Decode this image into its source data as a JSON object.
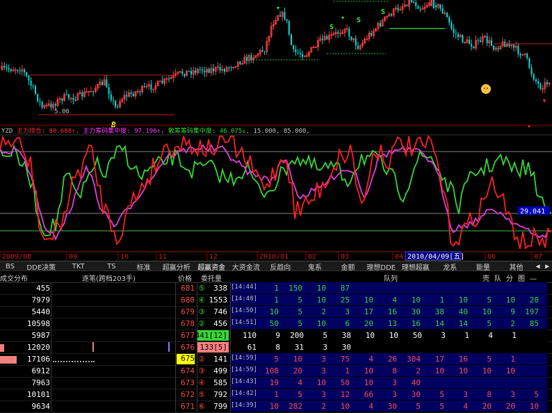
{
  "chart": {
    "indicator_name": "YZD",
    "legend": [
      {
        "label": "主力持仓",
        "value": "80.688↑",
        "color": "#ff3030"
      },
      {
        "label": "主力筹码集中度",
        "value": "97.196↑",
        "color": "#ff3cff"
      },
      {
        "label": "散筹筹码集中度",
        "value": "46.075↓",
        "color": "#35d835"
      },
      {
        "label": "",
        "value": "15.000",
        "color": "#c0c0c0"
      },
      {
        "label": "",
        "value": "85.000",
        "color": "#c0c0c0"
      }
    ],
    "value_tag": "29.041",
    "date_tag": "2010/04/09[五]",
    "months": [
      "2009/08",
      "09",
      "10",
      "11",
      "12",
      "2010/01",
      "02",
      "03",
      "04",
      "05",
      "06",
      "07"
    ],
    "candle_price_label": "5.00",
    "b_marker": "B",
    "s_markers": [
      "S",
      "S",
      "S"
    ]
  },
  "tabs": [
    "BS",
    "DDE决策",
    "TKT",
    "TS",
    "标准",
    "超赢分析",
    "超赢资金",
    "大资金流",
    "反趋向",
    "鬼系",
    "金额",
    "理想DDE",
    "理想超赢",
    "龙系",
    "能量",
    "其他"
  ],
  "tab_nav": [
    "◀",
    "▶"
  ],
  "header": {
    "col_dist": "成交分布",
    "col_ticks": "逐笔(跨档203手)",
    "col_price": "价格",
    "col_order": "委托量",
    "col_queue": "队列",
    "right_tabs": [
      "壳",
      "队",
      "分",
      "图",
      "—",
      "×"
    ]
  },
  "colors": {
    "up": "#ff4b4b",
    "green": "#35d835",
    "yellow": "#ffff00",
    "white": "#ffffff",
    "blue_bg": "#000060"
  },
  "rows": [
    {
      "vol": "455",
      "bar": 0,
      "price": "681",
      "num": "⑤",
      "qty": "338",
      "time": "[14:44]",
      "queue": [
        "1",
        "150",
        "10",
        "87"
      ]
    },
    {
      "vol": "7979",
      "bar": 0,
      "price": "680",
      "num": "④",
      "qty": "1553",
      "time": "[14:48]",
      "queue": [
        "1",
        "5",
        "10",
        "25",
        "10",
        "4",
        "10",
        "1",
        "10",
        "5",
        "10",
        "20"
      ]
    },
    {
      "vol": "5440",
      "bar": 0,
      "price": "679",
      "num": "③",
      "qty": "746",
      "time": "[14:50]",
      "queue": [
        "10",
        "5",
        "2",
        "3",
        "17",
        "16",
        "30",
        "38",
        "40",
        "10",
        "9",
        "197"
      ]
    },
    {
      "vol": "10598",
      "bar": 0,
      "price": "678",
      "num": "②",
      "qty": "456",
      "time": "[14:51]",
      "queue": [
        "50",
        "5",
        "10",
        "6",
        "20",
        "13",
        "16",
        "14",
        "14",
        "5",
        "2",
        "85"
      ]
    },
    {
      "vol": "5987",
      "bar": 0,
      "price": "677",
      "num": "",
      "qty": "441[12]",
      "time": "",
      "queue": [
        "110",
        "9",
        "200",
        "5",
        "38",
        "10",
        "10",
        "50",
        "3",
        "1",
        "4",
        "1"
      ]
    },
    {
      "vol": "12020",
      "bar": 6,
      "price": "676",
      "num": "",
      "qty": "133[5]",
      "time": "",
      "queue": [
        "61",
        "8",
        "31",
        "3",
        "30"
      ]
    },
    {
      "vol": "17106",
      "bar": 24,
      "price": "675",
      "num": "②",
      "qty": "141",
      "time": "[14:59]",
      "queue": [
        "5",
        "10",
        "3",
        "75",
        "4",
        "26",
        "304",
        "17",
        "16",
        "5",
        "1"
      ]
    },
    {
      "vol": "6912",
      "bar": 0,
      "price": "674",
      "num": "③",
      "qty": "499",
      "time": "[14:59]",
      "queue": [
        "108",
        "20",
        "3",
        "1",
        "10",
        "8",
        "2",
        "10",
        "10",
        "10",
        "10"
      ]
    },
    {
      "vol": "7963",
      "bar": 0,
      "price": "673",
      "num": "④",
      "qty": "585",
      "time": "[14:43]",
      "queue": [
        "19",
        "4",
        "10",
        "50",
        "10",
        "3",
        "40"
      ]
    },
    {
      "vol": "10101",
      "bar": 0,
      "price": "672",
      "num": "⑤",
      "qty": "792",
      "time": "[14:42]",
      "queue": [
        "1",
        "5",
        "3",
        "12",
        "66",
        "3",
        "30",
        "5",
        "3",
        "8",
        "3",
        "5"
      ]
    },
    {
      "vol": "9634",
      "bar": 0,
      "price": "671",
      "num": "⑥",
      "qty": "799",
      "time": "[14:39]",
      "queue": [
        "10",
        "282",
        "2",
        "10",
        "4",
        "30",
        "5",
        "5",
        "4",
        "20",
        "20",
        "10"
      ]
    }
  ]
}
